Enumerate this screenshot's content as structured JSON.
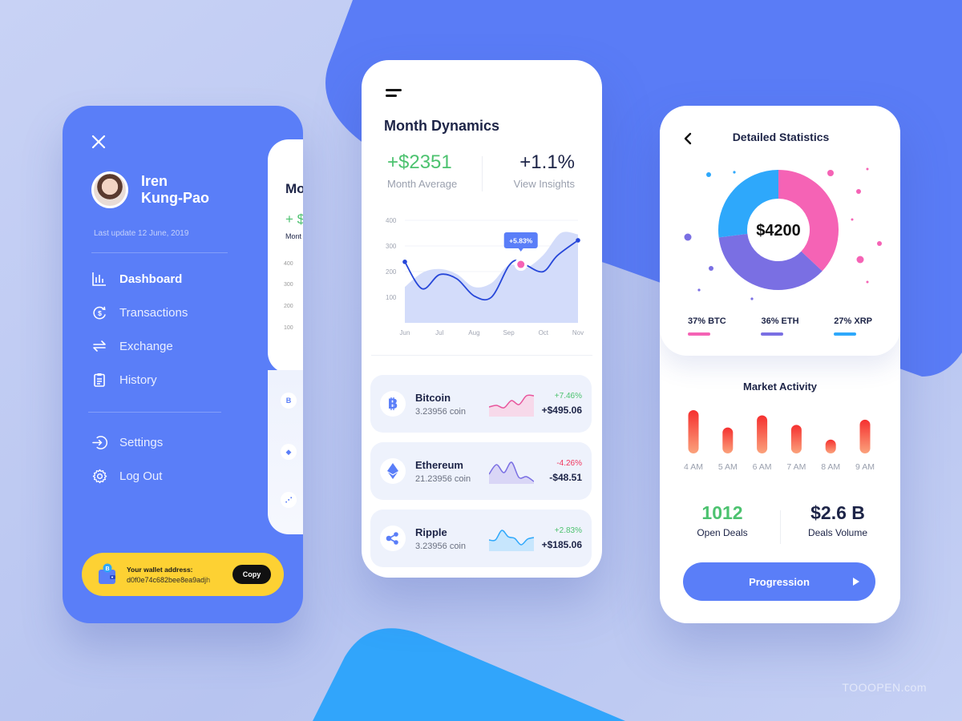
{
  "colors": {
    "primary": "#5a7ef8",
    "green": "#4cc26f",
    "red": "#f0365e",
    "dark": "#1d2447",
    "btc": "#f563b5",
    "eth": "#7a6fe3",
    "xrp": "#2ea8fb",
    "wallet_yellow": "#fdd133"
  },
  "menu_screen": {
    "close_icon": "close-icon",
    "user": {
      "first_name": "Iren",
      "last_name": "Kung-Pao"
    },
    "last_update": "Last update 12 June, 2019",
    "nav": [
      {
        "label": "Dashboard",
        "icon": "bar-chart-icon",
        "active": true
      },
      {
        "label": "Transactions",
        "icon": "dollar-refresh-icon",
        "active": false
      },
      {
        "label": "Exchange",
        "icon": "exchange-arrows-icon",
        "active": false
      },
      {
        "label": "History",
        "icon": "clipboard-icon",
        "active": false
      }
    ],
    "secondary_nav": [
      {
        "label": "Settings",
        "icon": "sign-in-icon"
      },
      {
        "label": "Log Out",
        "icon": "gear-icon"
      }
    ],
    "wallet": {
      "label": "Your wallet address:",
      "address": "d0f0e74c682bee8ea9adjh",
      "copy_label": "Copy"
    },
    "peek": {
      "title": "Mo",
      "value": "+ $",
      "sub": "Mont",
      "ticks": [
        "400",
        "300",
        "200",
        "100"
      ],
      "icons": [
        "B",
        "◆",
        "⋰"
      ]
    }
  },
  "dynamics_screen": {
    "title": "Month Dynamics",
    "month_average": {
      "value": "+$2351",
      "label": "Month Average"
    },
    "insights": {
      "value": "+1.1%",
      "label": "View Insights"
    },
    "tooltip": "+5.83%",
    "coins": [
      {
        "name": "Bitcoin",
        "symbol": "₿",
        "amount": "3.23956 coin",
        "change": "+7.46%",
        "usd": "+$495.06",
        "trend": "up",
        "spark_color": "#e8559c",
        "spark_fill": "#f7d9ea",
        "spark": [
          12,
          14,
          11,
          20,
          15,
          26,
          26
        ]
      },
      {
        "name": "Ethereum",
        "symbol": "◆",
        "amount": "21.23956 coin",
        "change": "-4.26%",
        "usd": "-$48.51",
        "trend": "down",
        "spark_color": "#7a6fe3",
        "spark_fill": "#d9d6f6",
        "spark": [
          12,
          24,
          14,
          27,
          8,
          9,
          3
        ]
      },
      {
        "name": "Ripple",
        "symbol": "xrp",
        "amount": "3.23956 coin",
        "change": "+2.83%",
        "usd": "+$185.06",
        "trend": "up",
        "spark_color": "#2ea8fb",
        "spark_fill": "#c7e6fd",
        "spark": [
          14,
          14,
          26,
          18,
          16,
          8,
          15,
          17
        ]
      }
    ]
  },
  "chart_data": [
    {
      "type": "line",
      "title": "Month Dynamics",
      "categories": [
        "Jun",
        "Jul",
        "Aug",
        "Sep",
        "Oct",
        "Nov"
      ],
      "yticks": [
        "400",
        "300",
        "200",
        "100"
      ],
      "ylim": [
        0,
        400
      ],
      "series": [
        {
          "name": "line",
          "x": [
            0,
            0.5,
            1,
            1.5,
            2,
            2.5,
            3,
            3.3,
            3.55,
            4,
            4.4,
            5
          ],
          "values": [
            238,
            133,
            188,
            172,
            105,
            100,
            222,
            245,
            222,
            200,
            262,
            322
          ]
        },
        {
          "name": "area",
          "x": [
            0,
            0.5,
            1,
            1.5,
            2,
            2.5,
            3,
            3.5,
            4,
            4.5,
            5
          ],
          "values": [
            140,
            195,
            210,
            190,
            140,
            155,
            225,
            215,
            265,
            350,
            345
          ]
        }
      ],
      "highlight": {
        "x": 3.35,
        "value": 228,
        "label": "+5.83%"
      },
      "grid": true
    },
    {
      "type": "pie",
      "title": "Detailed Statistics",
      "center_label": "$4200",
      "slices": [
        {
          "label": "BTC",
          "percent": 37,
          "color": "#f563b5"
        },
        {
          "label": "ETH",
          "percent": 36,
          "color": "#7a6fe3"
        },
        {
          "label": "XRP",
          "percent": 27,
          "color": "#2ea8fb"
        }
      ]
    },
    {
      "type": "bar",
      "title": "Market Activity",
      "categories": [
        "4 AM",
        "5 AM",
        "6 AM",
        "7 AM",
        "8 AM",
        "9 AM"
      ],
      "values": [
        100,
        60,
        88,
        66,
        32,
        78
      ],
      "ylim": [
        0,
        100
      ]
    }
  ],
  "stats_screen": {
    "title": "Detailed Statistics",
    "total": "$4200",
    "legend": [
      {
        "label": "37% BTC",
        "color": "#f563b5"
      },
      {
        "label": "36% ETH",
        "color": "#7a6fe3"
      },
      {
        "label": "27% XRP",
        "color": "#2ea8fb"
      }
    ],
    "market_title": "Market Activity",
    "open_deals": {
      "value": "1012",
      "label": "Open Deals"
    },
    "deals_volume": {
      "value": "$2.6 B",
      "label": "Deals Volume"
    },
    "button_label": "Progression"
  },
  "watermark": "TOOOPEN.com"
}
